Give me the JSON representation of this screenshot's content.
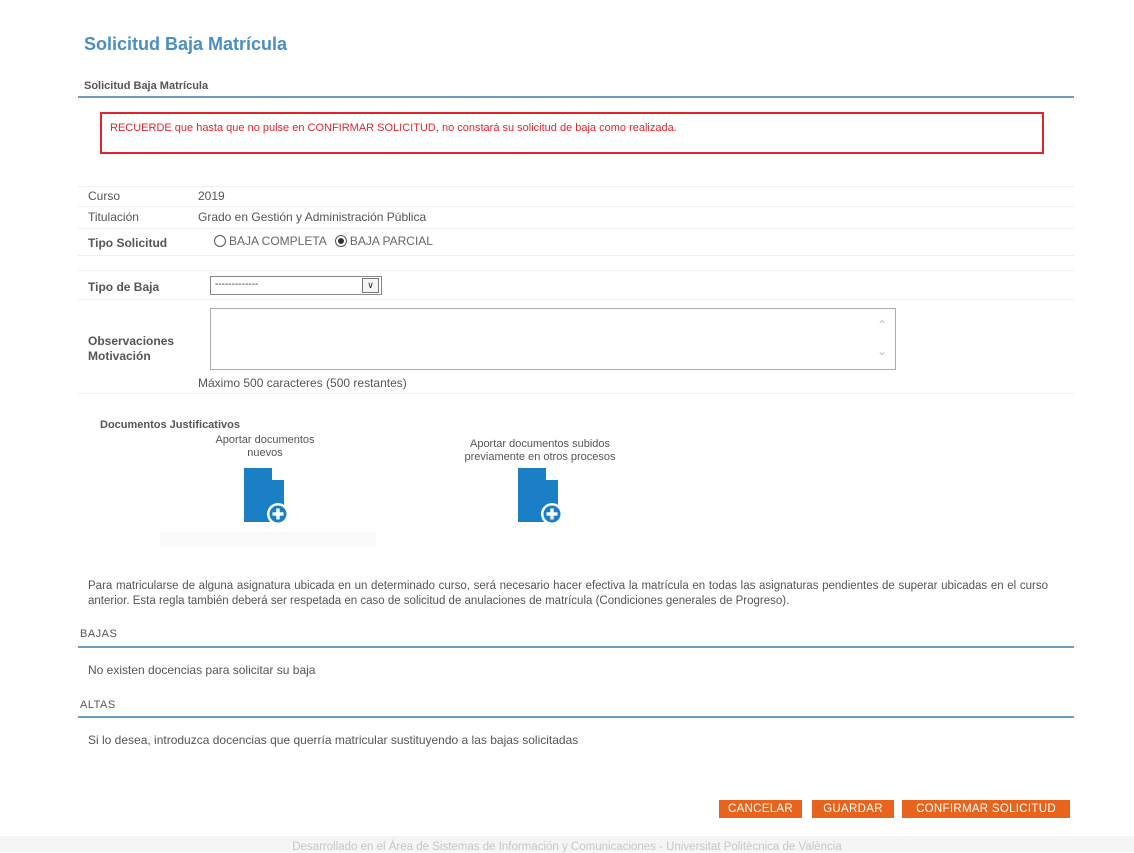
{
  "page": {
    "title": "Solicitud Baja Matrícula",
    "subtitle": "Solicitud Baja Matrícula"
  },
  "notice": "RECUERDE que hasta que no pulse en CONFIRMAR SOLICITUD, no constará su solicitud de baja como realizada.",
  "form": {
    "curso_label": "Curso",
    "curso_value": "2019",
    "titulacion_label": "Titulación",
    "titulacion_value": "Grado en Gestión y Administración Pública",
    "tipo_solicitud_label": "Tipo Solicitud",
    "tipo_solicitud_options": [
      {
        "label": "BAJA COMPLETA",
        "checked": false
      },
      {
        "label": "BAJA PARCIAL",
        "checked": true
      }
    ],
    "tipo_baja_label": "Tipo de Baja",
    "tipo_baja_selected": "-------------",
    "observaciones_label_line1": "Observaciones",
    "observaciones_label_line2": "Motivación",
    "observaciones_value": "",
    "counter_text": "Máximo 500 caracteres (500 restantes)"
  },
  "documents": {
    "title": "Documentos Justificativos",
    "new_line1": "Aportar documentos",
    "new_line2": "nuevos",
    "prev_line1": "Aportar documentos subidos",
    "prev_line2": "previamente en otros procesos",
    "icon": "document-add-icon",
    "icon_color": "#1a7fc4"
  },
  "info_text": "Para matricularse de alguna asignatura ubicada en un determinado curso, será necesario hacer efectiva la matrícula en todas las asignaturas pendientes de superar ubicadas en el curso anterior. Esta regla también deberá ser respetada en caso de solicitud de anulaciones de matrícula (Condiciones generales de Progreso).",
  "bajas": {
    "heading": "BAJAS",
    "text": "No existen docencias para solicitar su baja"
  },
  "altas": {
    "heading": "ALTAS",
    "text": "Si lo desea, introduzca docencias que querría matricular sustituyendo a las bajas solicitadas"
  },
  "buttons": {
    "cancel": "CANCELAR",
    "save": "GUARDAR",
    "confirm": "CONFIRMAR SOLICITUD",
    "color": "#e8641c"
  },
  "footer": "Desarrollado en el Área de Sistemas de Información y Comunicaciones - Universitat Politècnica de València",
  "colors": {
    "title_blue": "#4a8ec2",
    "rule_blue": "#6a9cc4",
    "notice_red": "#e0252d"
  }
}
